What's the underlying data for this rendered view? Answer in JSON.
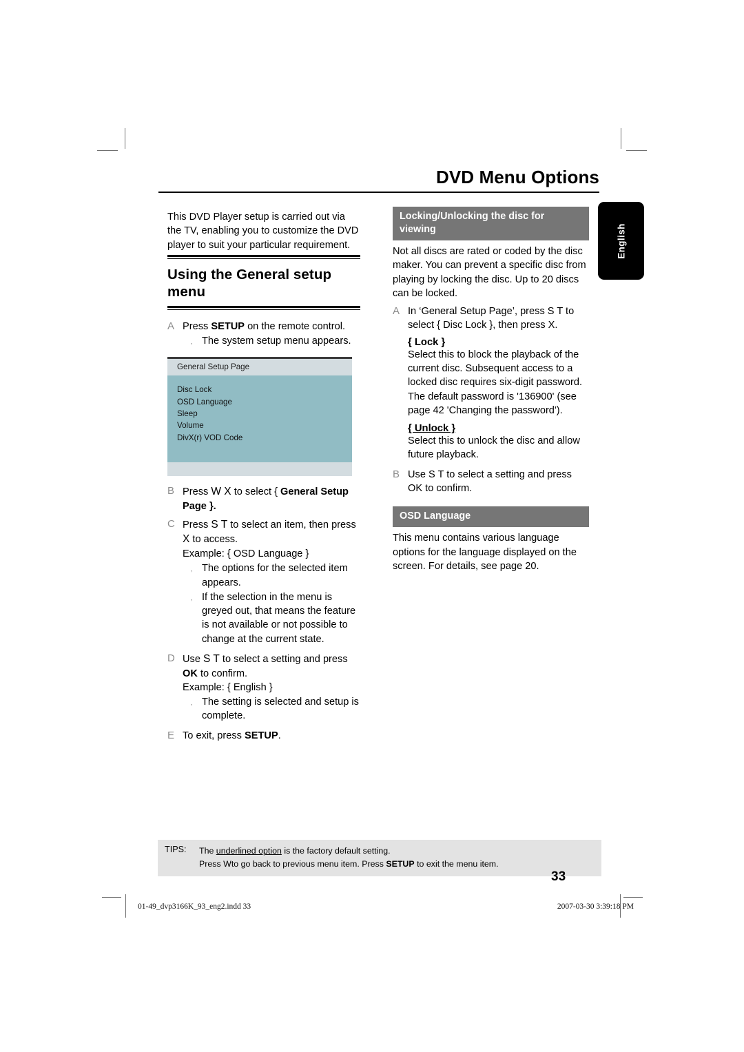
{
  "header": {
    "title": "DVD Menu Options"
  },
  "side_tab": {
    "label": "English"
  },
  "left_column": {
    "intro": "This DVD Player setup is carried out via the TV, enabling you to customize the DVD player to suit your particular requirement.",
    "section_heading": "Using the General setup menu",
    "steps": [
      {
        "letter": "A",
        "text_parts": [
          "Press ",
          "SETUP",
          " on the remote control."
        ],
        "bullets": [
          "The system setup menu appears."
        ]
      },
      {
        "letter": "B",
        "text_parts": [
          "Press ",
          "W X",
          " to select { ",
          "General Setup Page",
          " }."
        ],
        "bullets": []
      },
      {
        "letter": "C",
        "text_parts": [
          "Press ",
          "S T",
          " to select an item, then press ",
          "X",
          " to access."
        ],
        "example": "Example: { OSD Language }",
        "bullets": [
          "The options for the selected item appears.",
          "If the selection in the menu is greyed out, that means the feature is not available or not possible to change at the current state."
        ]
      },
      {
        "letter": "D",
        "text_parts": [
          "Use ",
          "S T",
          " to select a setting and press ",
          "OK",
          " to confirm."
        ],
        "example": "Example: { English }",
        "bullets": [
          "The setting is selected and setup is complete."
        ]
      },
      {
        "letter": "E",
        "text_parts": [
          "To exit, press ",
          "SETUP",
          "."
        ],
        "bullets": []
      }
    ],
    "setup_screen": {
      "title": "General Setup Page",
      "items": [
        "Disc Lock",
        "OSD Language",
        "Sleep",
        "Volume",
        "DivX(r) VOD Code"
      ]
    }
  },
  "right_column": {
    "lock_section": {
      "bar_title": "Locking/Unlocking the disc for viewing",
      "intro": "Not all discs are rated or coded by the disc maker. You can prevent a specific disc from playing by locking the disc. Up to 20 discs can be locked.",
      "step_a_letter": "A",
      "step_a_text": "In ‘General Setup Page’, press S T to select { Disc Lock }, then press X.",
      "lock_title": "{ Lock }",
      "lock_text": "Select this to block the playback of the current disc. Subsequent access to a locked disc requires six-digit password. The default password is '136900' (see page 42 'Changing the password').",
      "unlock_title": "{ Unlock }",
      "unlock_text": "Select this to unlock the disc and allow future playback.",
      "step_b_letter": "B",
      "step_b_text": "Use S T to select a setting and press OK to confirm."
    },
    "osd_section": {
      "bar_title": "OSD Language",
      "text": "This menu contains various language options for the language displayed on the screen. For details, see page 20."
    }
  },
  "tips": {
    "label": "TIPS:",
    "line1_pre": "The ",
    "line1_underlined": "underlined option",
    "line1_post": " is the factory default setting.",
    "line2_pre": "Press  W",
    "line2_mid": "to go back to previous menu item. Press ",
    "line2_bold": "SETUP",
    "line2_post": " to exit the menu item."
  },
  "page_number": "33",
  "footer": {
    "file": "01-49_dvp3166K_93_eng2.indd   33",
    "date": "2007-03-30   3:39:18 PM"
  },
  "colors": {
    "bar_gray": "#767676",
    "osd_teal": "#91bcc4",
    "osd_band": "#d3dce0",
    "tips_bg": "#e3e3e3",
    "tab_black": "#000000"
  }
}
